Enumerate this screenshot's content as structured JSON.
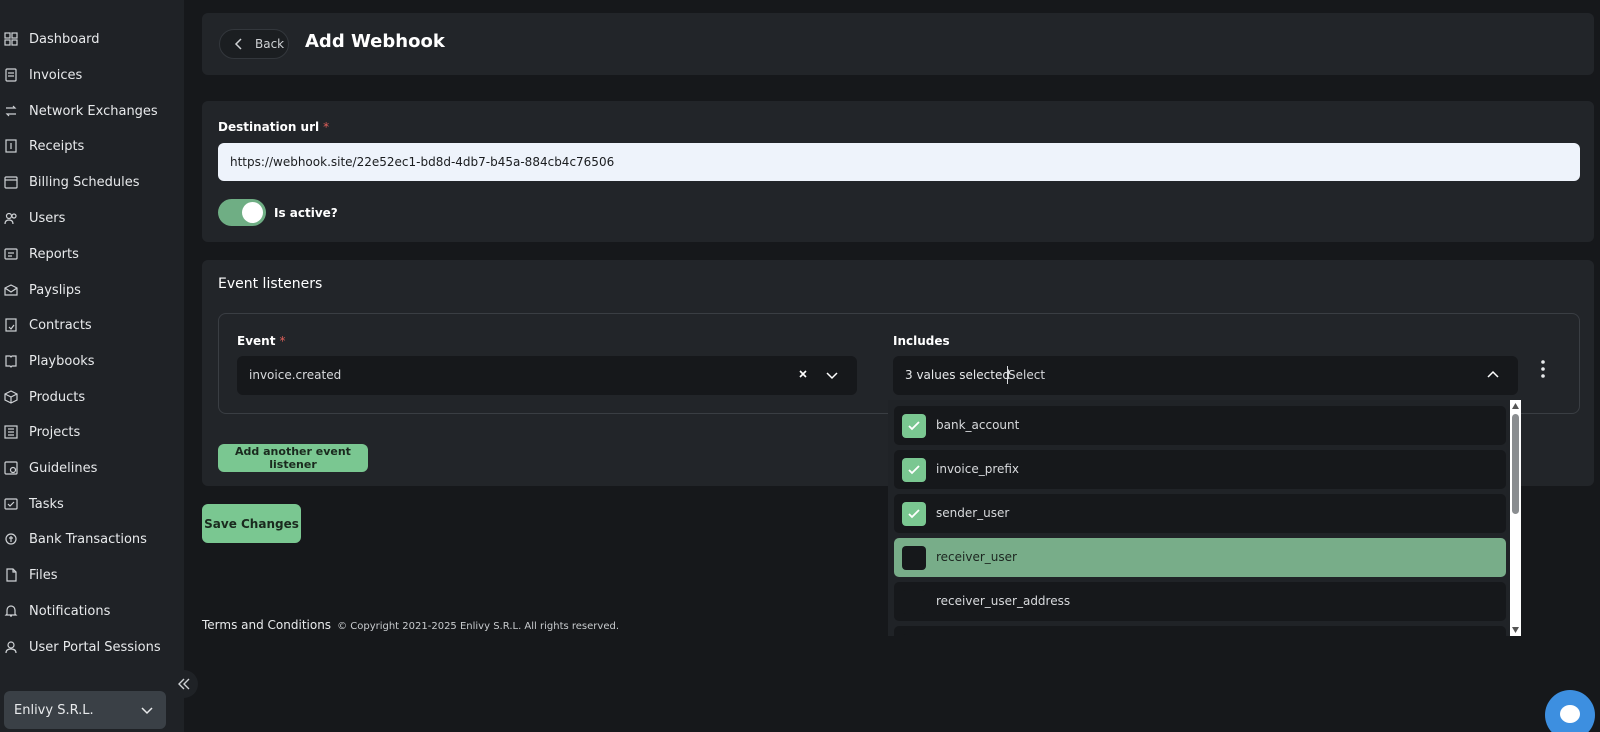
{
  "sidebar": {
    "items": [
      {
        "label": "Dashboard",
        "icon": "grid-icon"
      },
      {
        "label": "Invoices",
        "icon": "invoice-icon"
      },
      {
        "label": "Network Exchanges",
        "icon": "exchange-icon"
      },
      {
        "label": "Receipts",
        "icon": "receipt-icon"
      },
      {
        "label": "Billing Schedules",
        "icon": "calendar-icon"
      },
      {
        "label": "Users",
        "icon": "users-icon"
      },
      {
        "label": "Reports",
        "icon": "report-icon"
      },
      {
        "label": "Payslips",
        "icon": "payslip-icon"
      },
      {
        "label": "Contracts",
        "icon": "contract-icon"
      },
      {
        "label": "Playbooks",
        "icon": "book-icon"
      },
      {
        "label": "Products",
        "icon": "box-icon"
      },
      {
        "label": "Projects",
        "icon": "project-icon"
      },
      {
        "label": "Guidelines",
        "icon": "guideline-icon"
      },
      {
        "label": "Tasks",
        "icon": "task-icon"
      },
      {
        "label": "Bank Transactions",
        "icon": "bank-icon"
      },
      {
        "label": "Files",
        "icon": "file-icon"
      },
      {
        "label": "Notifications",
        "icon": "bell-icon"
      },
      {
        "label": "User Portal Sessions",
        "icon": "session-icon"
      }
    ],
    "org": "Enlivy S.R.L."
  },
  "header": {
    "back_label": "Back",
    "title": "Add Webhook"
  },
  "destination": {
    "label": "Destination url",
    "required_mark": "*",
    "value": "https://webhook.site/22e52ec1-bd8d-4db7-b45a-884cb4c76506",
    "active_label": "Is active?",
    "active": true
  },
  "events": {
    "title": "Event listeners",
    "event_label": "Event",
    "event_required_mark": "*",
    "event_value": "invoice.created",
    "includes_label": "Includes",
    "includes_count": "3 values selected",
    "includes_placeholder": "Select",
    "add_label": "Add another event listener"
  },
  "dropdown": {
    "options": [
      {
        "label": "bank_account",
        "checked": true,
        "highlighted": false
      },
      {
        "label": "invoice_prefix",
        "checked": true,
        "highlighted": false
      },
      {
        "label": "sender_user",
        "checked": true,
        "highlighted": false
      },
      {
        "label": "receiver_user",
        "checked": false,
        "highlighted": true
      },
      {
        "label": "receiver_user_address",
        "checked": false,
        "highlighted": false
      }
    ]
  },
  "save_label": "Save Changes",
  "footer": {
    "terms": "Terms and Conditions",
    "copyright": "© Copyright 2021-2025 Enlivy S.R.L. All rights reserved."
  },
  "colors": {
    "accent": "#7ac791",
    "highlight": "#78ad89",
    "required": "#e0605a",
    "chat": "#3d8fe0"
  }
}
